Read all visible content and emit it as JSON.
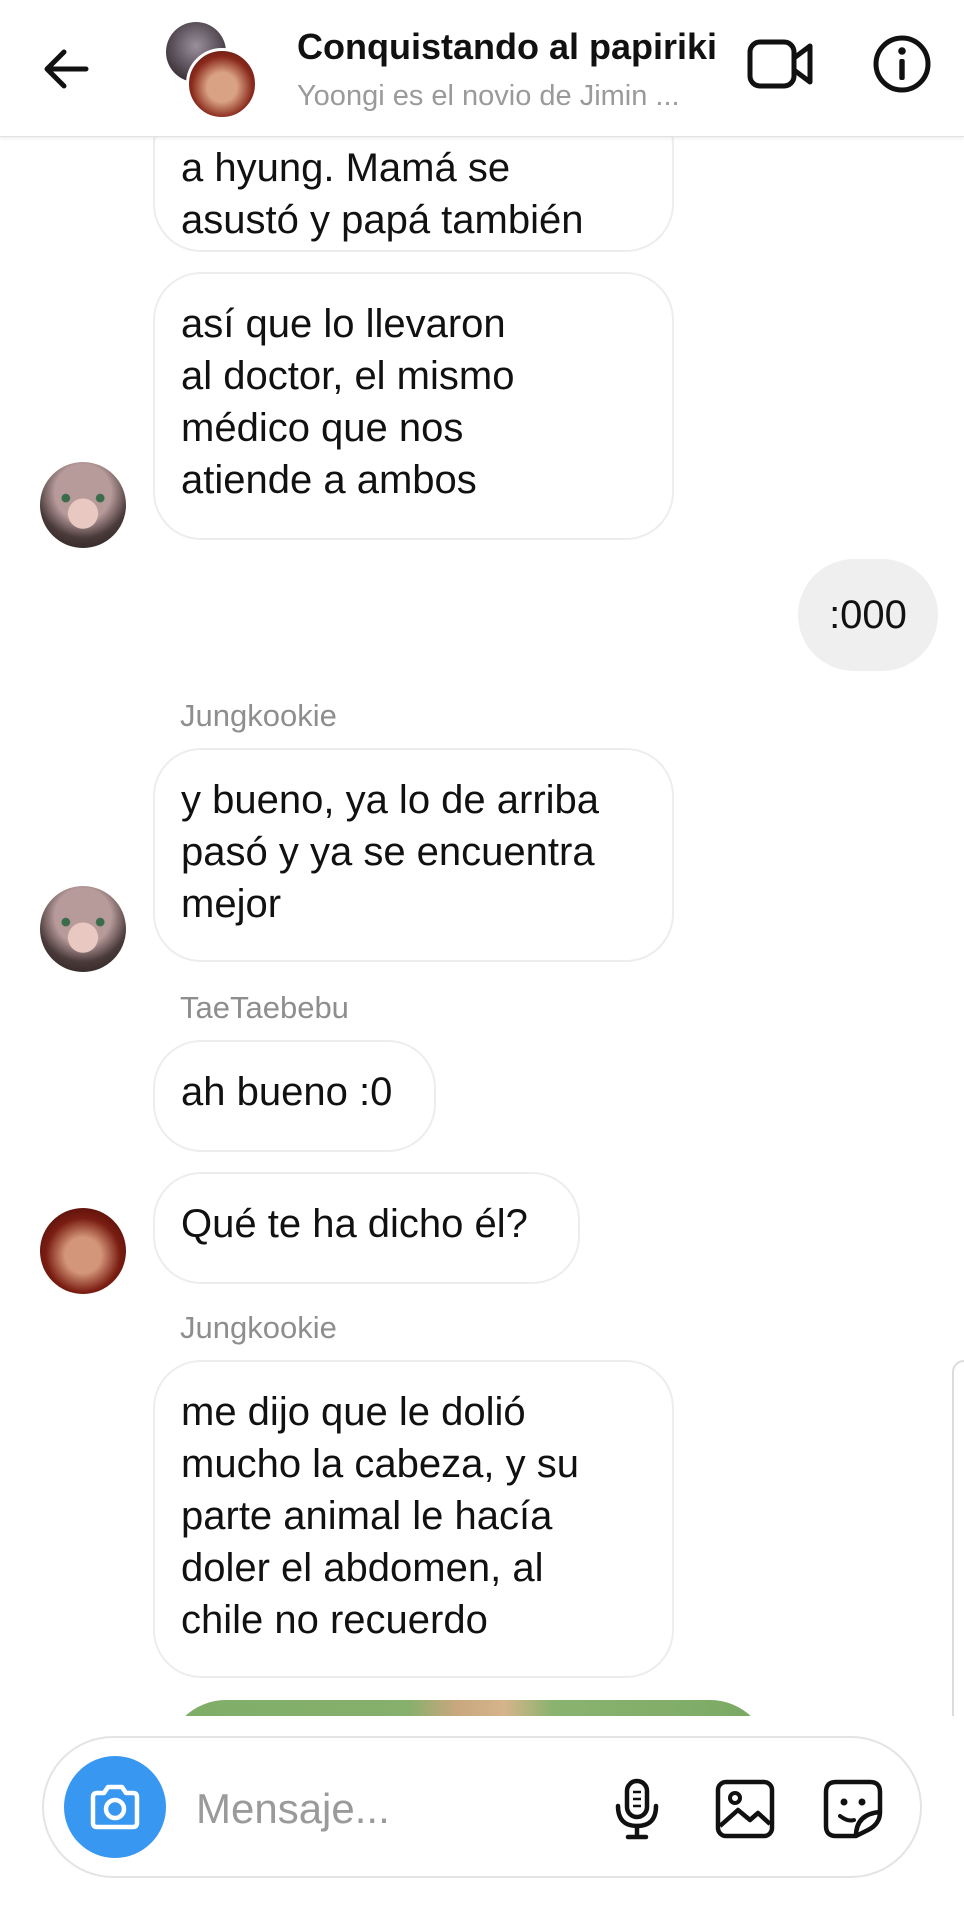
{
  "header": {
    "title": "Conquistando al papiriki",
    "subtitle": "Yoongi es el novio de Jimin ..."
  },
  "messages": {
    "m1": "a hyung. Mamá se\nasustó y papá también",
    "m2": "así que lo llevaron\nal doctor, el mismo\nmédico que nos\natiende a ambos",
    "m3": ":000",
    "s4": "Jungkookie",
    "m4": "y bueno, ya lo de arriba\npasó y ya se encuentra\nmejor",
    "s5": "TaeTaebebu",
    "m5": "ah bueno :0",
    "m6": "Qué te ha dicho él?",
    "s7": "Jungkookie",
    "m7": "me dijo que le dolió\nmucho la cabeza, y su\nparte animal le hacía\ndoler el abdomen, al\nchile no recuerdo"
  },
  "composer": {
    "placeholder": "Mensaje..."
  },
  "icons": {
    "back": "arrow-left-icon",
    "video": "video-camera-icon",
    "info": "info-icon",
    "camera": "camera-icon",
    "mic": "microphone-icon",
    "gallery": "image-icon",
    "sticker": "sticker-icon"
  },
  "colors": {
    "accent": "#3897f0",
    "my_bubble": "#efefef",
    "their_bubble_border": "#ededed",
    "secondary_text": "#8e8e8e"
  }
}
